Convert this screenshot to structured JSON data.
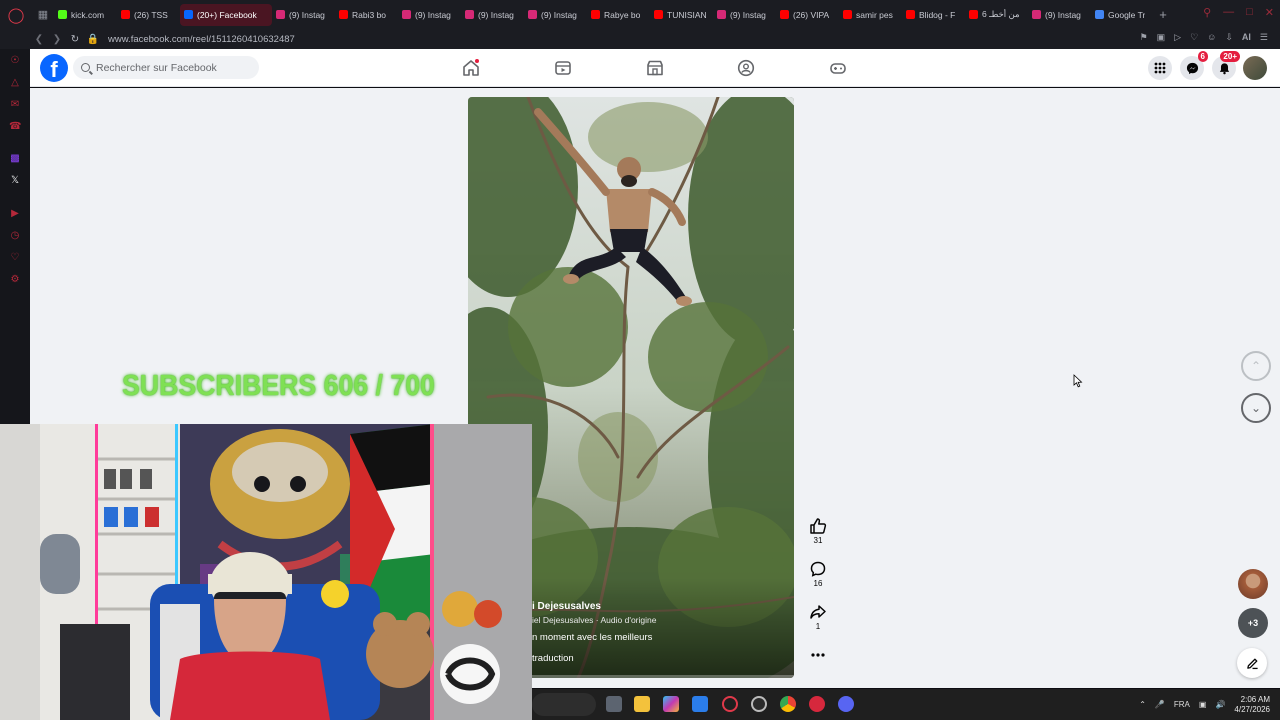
{
  "browser": {
    "tabs": [
      {
        "label": "kick.com",
        "fav_color": "#53fc18",
        "active": false
      },
      {
        "label": "(26) TSS",
        "fav_color": "#ff0000",
        "active": false
      },
      {
        "label": "(20+) Facebook",
        "fav_color": "#0866ff",
        "active": true
      },
      {
        "label": "(9) Instag",
        "fav_color": "#d62976",
        "active": false
      },
      {
        "label": "Rabi3 bo",
        "fav_color": "#ff0000",
        "active": false
      },
      {
        "label": "(9) Instag",
        "fav_color": "#d62976",
        "active": false
      },
      {
        "label": "(9) Instag",
        "fav_color": "#d62976",
        "active": false
      },
      {
        "label": "(9) Instag",
        "fav_color": "#d62976",
        "active": false
      },
      {
        "label": "Rabye bo",
        "fav_color": "#ff0000",
        "active": false
      },
      {
        "label": "TUNISIAN",
        "fav_color": "#ff0000",
        "active": false
      },
      {
        "label": "(9) Instag",
        "fav_color": "#d62976",
        "active": false
      },
      {
        "label": "(26) VIPA",
        "fav_color": "#ff0000",
        "active": false
      },
      {
        "label": "samir pes",
        "fav_color": "#ff0000",
        "active": false
      },
      {
        "label": "Blidog - F",
        "fav_color": "#ff0000",
        "active": false
      },
      {
        "label": "6 من أخطـ",
        "fav_color": "#ff0000",
        "active": false
      },
      {
        "label": "(9) Instag",
        "fav_color": "#d62976",
        "active": false
      },
      {
        "label": "Google Tr",
        "fav_color": "#4285f4",
        "active": false
      }
    ],
    "new_tab": "+",
    "url": "www.facebook.com/reel/1511260410632487",
    "ai_label": "AI"
  },
  "facebook": {
    "logo_letter": "f",
    "search_placeholder": "Rechercher sur Facebook",
    "messenger_badge": "6",
    "notifications_badge": "20+"
  },
  "reel": {
    "author": "i Dejesusalves",
    "audio": "iel Dejesusalves · Audio d'origine",
    "caption": "n moment avec les meilleurs",
    "translation": "traduction",
    "progress": 0.12,
    "likes": "31",
    "comments": "16",
    "shares": "1"
  },
  "contacts": {
    "more_label": "+3"
  },
  "stream_overlay": {
    "subscribers_text": "SUBSCRIBERS 606 / 700"
  },
  "taskbar": {
    "language": "FRA",
    "time": "2:06 AM",
    "date": "4/27/2026"
  }
}
